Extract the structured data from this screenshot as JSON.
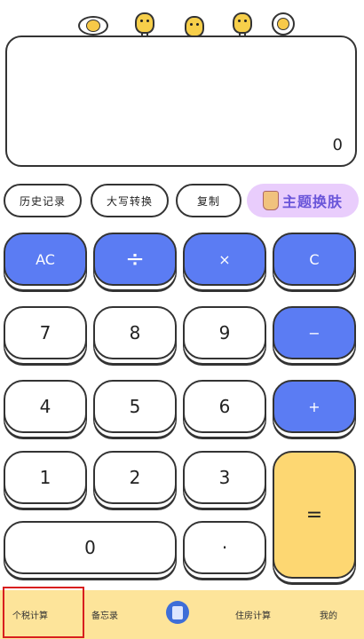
{
  "display": {
    "value": "0"
  },
  "functions": {
    "history": "历史记录",
    "uppercase": "大写转换",
    "copy": "复制",
    "theme": "主题换肤"
  },
  "keys": {
    "ac": "AC",
    "divide": "÷",
    "multiply": "×",
    "clear": "C",
    "seven": "7",
    "eight": "8",
    "nine": "9",
    "minus": "−",
    "four": "4",
    "five": "5",
    "six": "6",
    "plus": "+",
    "one": "1",
    "two": "2",
    "three": "3",
    "equals": "=",
    "zero": "0",
    "dot": "·"
  },
  "nav": {
    "tax": "个税计算",
    "notes": "备忘录",
    "house": "住房计算",
    "mine": "我的"
  },
  "colors": {
    "operator": "#5b7cf3",
    "equals": "#fdd772",
    "nav_bg": "#fde49a",
    "highlight": "#d81e1e"
  }
}
